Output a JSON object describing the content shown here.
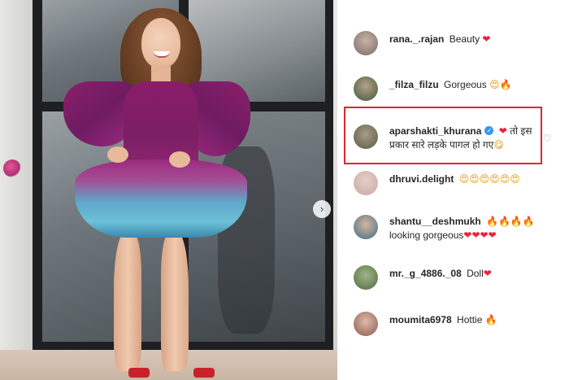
{
  "photo": {
    "nav_arrow_glyph": "›"
  },
  "comments": [
    {
      "username": "rana._.rajan",
      "text": "Beauty",
      "emoji": "❤",
      "avatar_color": "#7a6a64"
    },
    {
      "username": "_filza_filzu",
      "text": "Gorgeous",
      "emoji": "😍🔥",
      "avatar_color": "#3d5a3a"
    },
    {
      "username": "aparshakti_khurana",
      "verified": true,
      "text_line1": "तो इस",
      "text_line2": "प्रकार सारे लड़के पागल हो गए",
      "emoji_prefix": "❤",
      "emoji_suffix": "😋",
      "avatar_color": "#5b5a48",
      "highlighted": true
    },
    {
      "username": "dhruvi.delight",
      "text": "",
      "emoji": "😍😍😍😍😍😍",
      "avatar_color": "#c7a9a2"
    },
    {
      "username": "shantu__deshmukh",
      "text_line1": "",
      "emoji_line1": "🔥🔥🔥🔥",
      "text_line2": "looking gorgeous",
      "emoji_line2": "❤❤❤❤",
      "avatar_color": "#3c6e8a"
    },
    {
      "username": "mr._g_4886._08",
      "text": "Doll",
      "emoji": "❤",
      "avatar_color": "#4f6b3e"
    },
    {
      "username": "moumita6978",
      "text": "Hottie",
      "emoji": "🔥",
      "avatar_color": "#8a5b50"
    }
  ],
  "like_icon_glyph": "♡",
  "verified_glyph": "✓"
}
